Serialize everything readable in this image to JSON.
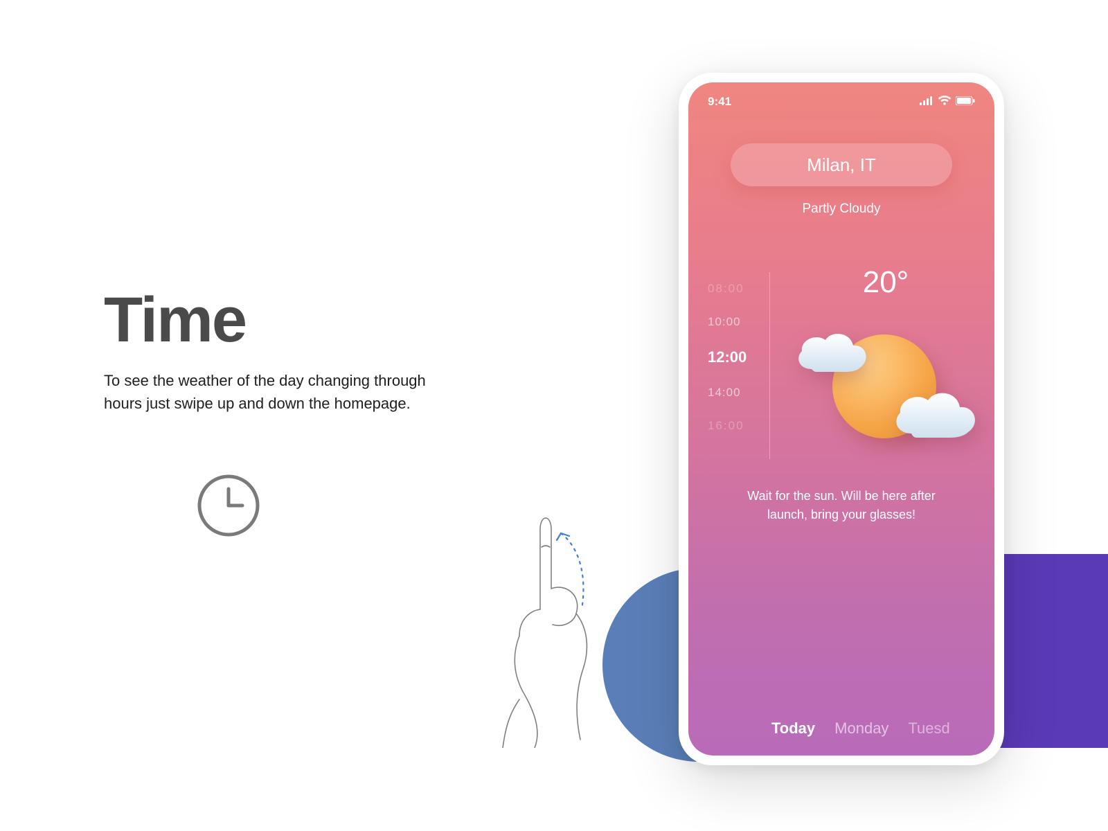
{
  "feature": {
    "title": "Time",
    "description": "To see the weather of the day changing through hours just swipe up and down the homepage."
  },
  "phone": {
    "status_time": "9:41",
    "location": "Milan, IT",
    "condition": "Partly Cloudy",
    "temperature": "20°",
    "times": [
      {
        "label": "08:00",
        "style": "faded"
      },
      {
        "label": "10:00",
        "style": "normal"
      },
      {
        "label": "12:00",
        "style": "active"
      },
      {
        "label": "14:00",
        "style": "normal"
      },
      {
        "label": "16:00",
        "style": "faded"
      }
    ],
    "advice": "Wait for the sun. Will be here after launch, bring your glasses!",
    "days": [
      {
        "label": "Today",
        "state": "active"
      },
      {
        "label": "Monday",
        "state": "normal"
      },
      {
        "label": "Tuesd",
        "state": "cut"
      }
    ]
  }
}
